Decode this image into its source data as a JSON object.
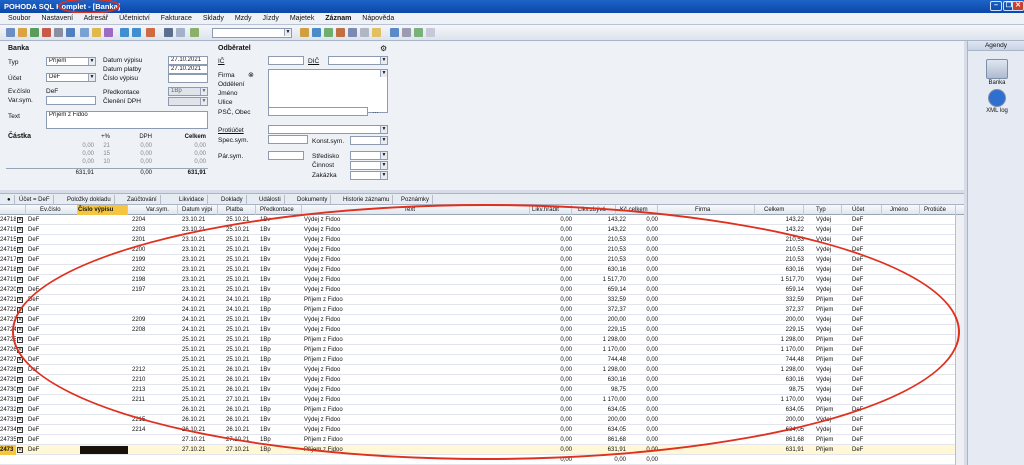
{
  "window": {
    "title": "POHODA SQL Komplet - [Banka]",
    "controls": [
      "–",
      "❐",
      "✕"
    ]
  },
  "menu": [
    "Soubor",
    "Nastavení",
    "Adresář",
    "Účetnictví",
    "Fakturace",
    "Sklady",
    "Mzdy",
    "Jízdy",
    "Majetek",
    "Záznam",
    "Nápověda"
  ],
  "form": {
    "section_banka": "Banka",
    "typ_label": "Typ",
    "typ_value": "Příjem",
    "ucet_label": "Účet",
    "ucet_value": "DeF",
    "evcislo_label": "Ev.číslo",
    "evcislo_value": "DeF",
    "varsym_label": "Var.sym.",
    "datum_vypisu_label": "Datum výpisu",
    "datum_vypisu_value": "27.10.2021",
    "datum_platby_label": "Datum platby",
    "datum_platby_value": "27.10.2021",
    "cislo_vypisu_label": "Číslo výpisu",
    "predkontace_label": "Předkontace",
    "predkontace_value": "1Bp",
    "cleneni_dph_label": "Členění DPH",
    "text_label": "Text",
    "text_value": "Příjem z Fidoo",
    "section_odberatel": "Odběratel",
    "ic_label": "IČ",
    "dic_label": "DIČ",
    "firma_label": "Firma",
    "oddeleni_label": "Oddělení",
    "jmeno_label": "Jméno",
    "ulice_label": "Ulice",
    "psc_label": "PSČ, Obec",
    "protiucet_label": "Protiúčet",
    "specsym_label": "Spec.sym.",
    "konstsym_label": "Konst.sym.",
    "parsym_label": "Pár.sym.",
    "stredisko_label": "Středisko",
    "cinnost_label": "Činnost",
    "zakazka_label": "Zakázka",
    "section_castka": "Částka",
    "sum_headers": [
      "+%",
      "DPH",
      "Celkem"
    ],
    "sum_rows": [
      [
        "0,00",
        "21",
        "0,00",
        "0,00"
      ],
      [
        "0,00",
        "15",
        "0,00",
        "0,00"
      ],
      [
        "0,00",
        "10",
        "0,00",
        "0,00"
      ]
    ],
    "sum_total_left": "631,91",
    "sum_total_mid": "0,00",
    "sum_total_right": "631,91"
  },
  "tabs": [
    "Účet = DeF",
    "Položky dokladu",
    "Zaúčtování",
    "Likvidace",
    "Doklady",
    "Události",
    "Dokumenty",
    "Historie záznamu",
    "Poznámky"
  ],
  "grid": {
    "columns": [
      "Ev.číslo",
      "Číslo výpisu",
      "Var.sym.",
      "Datum výpi",
      "Platba",
      "Předkontace",
      "Text",
      "Likv.hradit",
      "Likv.zbývá",
      "Kč celkem",
      "Firma",
      "Celkem",
      "Typ",
      "Účet",
      "Jméno",
      "Protiúče"
    ],
    "rows": [
      [
        "24718",
        "DeF",
        "",
        "2204",
        "23.10.21",
        "25.10.21",
        "1Bv",
        "Výdej z Fidoo",
        "0,00",
        "143,22",
        "0,00",
        "",
        "143,22",
        "Výdej",
        "DeF"
      ],
      [
        "24719",
        "DeF",
        "",
        "2203",
        "23.10.21",
        "25.10.21",
        "1Bv",
        "Výdej z Fidoo",
        "0,00",
        "143,22",
        "0,00",
        "",
        "143,22",
        "Výdej",
        "DeF"
      ],
      [
        "24715",
        "DeF",
        "",
        "2201",
        "23.10.21",
        "25.10.21",
        "1Bv",
        "Výdej z Fidoo",
        "0,00",
        "210,53",
        "0,00",
        "",
        "210,53",
        "Výdej",
        "DeF"
      ],
      [
        "24716",
        "DeF",
        "",
        "2200",
        "23.10.21",
        "25.10.21",
        "1Bv",
        "Výdej z Fidoo",
        "0,00",
        "210,53",
        "0,00",
        "",
        "210,53",
        "Výdej",
        "DeF"
      ],
      [
        "24717",
        "DeF",
        "",
        "2199",
        "23.10.21",
        "25.10.21",
        "1Bv",
        "Výdej z Fidoo",
        "0,00",
        "210,53",
        "0,00",
        "",
        "210,53",
        "Výdej",
        "DeF"
      ],
      [
        "24718",
        "DeF",
        "",
        "2202",
        "23.10.21",
        "25.10.21",
        "1Bv",
        "Výdej z Fidoo",
        "0,00",
        "630,16",
        "0,00",
        "",
        "630,16",
        "Výdej",
        "DeF"
      ],
      [
        "24719",
        "DeF",
        "",
        "2198",
        "23.10.21",
        "25.10.21",
        "1Bv",
        "Výdej z Fidoo",
        "0,00",
        "1 517,70",
        "0,00",
        "",
        "1 517,70",
        "Výdej",
        "DeF"
      ],
      [
        "24720",
        "DeF",
        "",
        "2197",
        "23.10.21",
        "25.10.21",
        "1Bv",
        "Výdej z Fidoo",
        "0,00",
        "659,14",
        "0,00",
        "",
        "659,14",
        "Výdej",
        "DeF"
      ],
      [
        "24721",
        "DeF",
        "",
        "",
        "24.10.21",
        "24.10.21",
        "1Bp",
        "Příjem z Fidoo",
        "0,00",
        "332,59",
        "0,00",
        "",
        "332,59",
        "Příjem",
        "DeF"
      ],
      [
        "24722",
        "DeF",
        "",
        "",
        "24.10.21",
        "24.10.21",
        "1Bp",
        "Příjem z Fidoo",
        "0,00",
        "372,37",
        "0,00",
        "",
        "372,37",
        "Příjem",
        "DeF"
      ],
      [
        "24723",
        "DeF",
        "",
        "2209",
        "24.10.21",
        "25.10.21",
        "1Bv",
        "Výdej z Fidoo",
        "0,00",
        "200,00",
        "0,00",
        "",
        "200,00",
        "Výdej",
        "DeF"
      ],
      [
        "24724",
        "DeF",
        "",
        "2208",
        "24.10.21",
        "25.10.21",
        "1Bv",
        "Výdej z Fidoo",
        "0,00",
        "229,15",
        "0,00",
        "",
        "229,15",
        "Výdej",
        "DeF"
      ],
      [
        "24725",
        "DeF",
        "",
        "",
        "25.10.21",
        "25.10.21",
        "1Bp",
        "Příjem z Fidoo",
        "0,00",
        "1 298,00",
        "0,00",
        "",
        "1 298,00",
        "Příjem",
        "DeF"
      ],
      [
        "24726",
        "DeF",
        "",
        "",
        "25.10.21",
        "25.10.21",
        "1Bp",
        "Příjem z Fidoo",
        "0,00",
        "1 170,00",
        "0,00",
        "",
        "1 170,00",
        "Příjem",
        "DeF"
      ],
      [
        "24727",
        "DeF",
        "",
        "",
        "25.10.21",
        "25.10.21",
        "1Bp",
        "Příjem z Fidoo",
        "0,00",
        "744,48",
        "0,00",
        "",
        "744,48",
        "Příjem",
        "DeF"
      ],
      [
        "24728",
        "DeF",
        "",
        "2212",
        "25.10.21",
        "26.10.21",
        "1Bv",
        "Výdej z Fidoo",
        "0,00",
        "1 298,00",
        "0,00",
        "",
        "1 298,00",
        "Výdej",
        "DeF"
      ],
      [
        "24729",
        "DeF",
        "",
        "2210",
        "25.10.21",
        "26.10.21",
        "1Bv",
        "Výdej z Fidoo",
        "0,00",
        "630,16",
        "0,00",
        "",
        "630,16",
        "Výdej",
        "DeF"
      ],
      [
        "24730",
        "DeF",
        "",
        "2213",
        "25.10.21",
        "26.10.21",
        "1Bv",
        "Výdej z Fidoo",
        "0,00",
        "98,75",
        "0,00",
        "",
        "98,75",
        "Výdej",
        "DeF"
      ],
      [
        "24731",
        "DeF",
        "",
        "2211",
        "25.10.21",
        "27.10.21",
        "1Bv",
        "Výdej z Fidoo",
        "0,00",
        "1 170,00",
        "0,00",
        "",
        "1 170,00",
        "Výdej",
        "DeF"
      ],
      [
        "24732",
        "DeF",
        "",
        "",
        "26.10.21",
        "26.10.21",
        "1Bp",
        "Příjem z Fidoo",
        "0,00",
        "634,05",
        "0,00",
        "",
        "634,05",
        "Příjem",
        "DeF"
      ],
      [
        "24733",
        "DeF",
        "",
        "2215",
        "26.10.21",
        "26.10.21",
        "1Bv",
        "Výdej z Fidoo",
        "0,00",
        "200,00",
        "0,00",
        "",
        "200,00",
        "Výdej",
        "DeF"
      ],
      [
        "24734",
        "DeF",
        "",
        "2214",
        "26.10.21",
        "26.10.21",
        "1Bv",
        "Výdej z Fidoo",
        "0,00",
        "634,05",
        "0,00",
        "",
        "634,05",
        "Výdej",
        "DeF"
      ],
      [
        "24735",
        "DeF",
        "",
        "",
        "27.10.21",
        "27.10.21",
        "1Bp",
        "Příjem z Fidoo",
        "0,00",
        "861,68",
        "0,00",
        "",
        "861,68",
        "Příjem",
        "DeF"
      ],
      [
        "2473",
        "DeF",
        "",
        "",
        "27.10.21",
        "27.10.21",
        "1Bp",
        "Příjem z Fidoo",
        "0,00",
        "631,91",
        "0,00",
        "",
        "631,91",
        "Příjem",
        "DeF"
      ]
    ],
    "footer_values": [
      "0,00",
      "0,00",
      "0,00"
    ]
  },
  "agenda": {
    "title": "Agendy",
    "items": [
      "Banka",
      "XML log"
    ]
  },
  "colors": {
    "titlebar": "#0b46a8",
    "highlight_col": "#f5c542",
    "annotation": "#e0301e"
  }
}
